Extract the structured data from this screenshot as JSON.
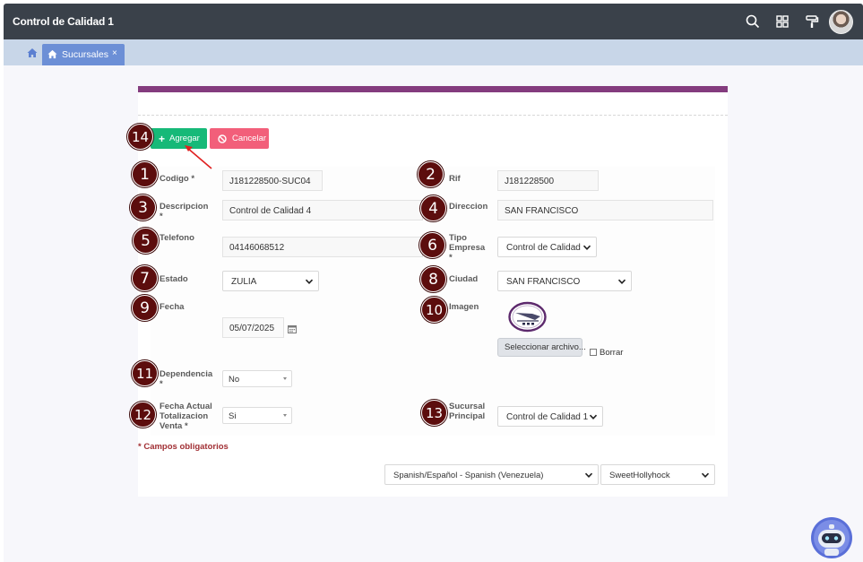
{
  "app": {
    "title": "Control de Calidad 1"
  },
  "toolbar_icons": [
    "search-icon",
    "grid-icon",
    "paint-roller-icon"
  ],
  "tabs": [
    {
      "label": "Sucursales",
      "close": "×"
    }
  ],
  "actions": {
    "add_label": "Agregar",
    "cancel_label": "Cancelar"
  },
  "form": {
    "codigo": {
      "label": "Codigo *",
      "value": "J181228500-SUC04"
    },
    "rif": {
      "label": "Rif",
      "value": "J181228500"
    },
    "descripcion": {
      "label_line1": "Descripcion",
      "label_line2": "*",
      "value": "Control de Calidad 4"
    },
    "direccion": {
      "label": "Direccion",
      "value": "SAN FRANCISCO"
    },
    "telefono": {
      "label": "Telefono",
      "value": "04146068512"
    },
    "tipo_empresa": {
      "label_line1": "Tipo",
      "label_line2": "Empresa",
      "label_line3": "*",
      "value": "Control de Calidad"
    },
    "estado": {
      "label": "Estado",
      "value": "ZULIA"
    },
    "ciudad": {
      "label": "Ciudad",
      "value": "SAN FRANCISCO"
    },
    "fecha": {
      "label": "Fecha",
      "value": "05/07/2025"
    },
    "imagen": {
      "label": "Imagen",
      "file_button": "Seleccionar archivo...",
      "delete_label": "Borrar"
    },
    "dependencia": {
      "label_line1": "Dependencia",
      "label_line2": "*",
      "value": "No"
    },
    "fecha_totalizacion": {
      "label_line1": "Fecha Actual",
      "label_line2": "Totalizacion",
      "label_line3": "Venta *",
      "value": "Si"
    },
    "sucursal_principal": {
      "label_line1": "Sucursal",
      "label_line2": "Principal",
      "value": "Control de Calidad 1"
    }
  },
  "required_note": "* Campos obligatorios",
  "footer": {
    "language": "Spanish/Español - Spanish (Venezuela)",
    "theme": "SweetHollyhock"
  },
  "annotations": [
    "1",
    "2",
    "3",
    "4",
    "5",
    "6",
    "7",
    "8",
    "9",
    "10",
    "11",
    "12",
    "13",
    "14"
  ],
  "colors": {
    "topbar": "#3a414a",
    "tabbar": "#c8d6e8",
    "tab": "#6c8fd6",
    "stripe": "#843c7e",
    "add": "#16b978",
    "cancel": "#f25f7a",
    "badge": "#5c0d0d",
    "required": "#a12f34"
  }
}
